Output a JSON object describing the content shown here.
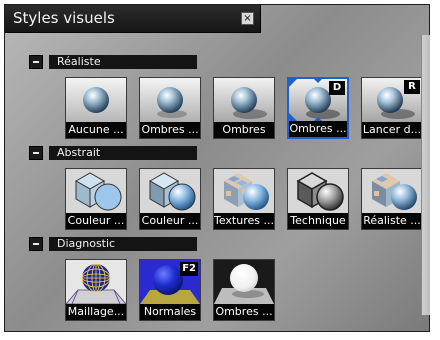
{
  "window": {
    "title": "Styles visuels",
    "close_symbol": "×"
  },
  "sections": [
    {
      "label": "Réaliste",
      "items": [
        {
          "label": "Aucune ...",
          "badge": "",
          "icon": "sphere-no-shadow-icon"
        },
        {
          "label": "Ombres ...",
          "badge": "",
          "icon": "sphere-ground-shadow-icon"
        },
        {
          "label": "Ombres",
          "badge": "",
          "icon": "sphere-shadow-icon"
        },
        {
          "label": "Ombres ...",
          "badge": "D",
          "icon": "sphere-full-shadow-icon",
          "selected": true
        },
        {
          "label": "Lancer d...",
          "badge": "R",
          "icon": "sphere-raytrace-icon"
        }
      ]
    },
    {
      "label": "Abstrait",
      "items": [
        {
          "label": "Couleur ...",
          "badge": "",
          "icon": "cube-flat-color-icon"
        },
        {
          "label": "Couleur ...",
          "badge": "",
          "icon": "cube-gradient-color-icon"
        },
        {
          "label": "Textures ...",
          "badge": "",
          "icon": "cube-textures-icon"
        },
        {
          "label": "Technique",
          "badge": "",
          "icon": "cube-technical-icon"
        },
        {
          "label": "Réaliste ...",
          "badge": "",
          "icon": "cube-realistic-icon"
        }
      ]
    },
    {
      "label": "Diagnostic",
      "items": [
        {
          "label": "Maillage...",
          "badge": "",
          "icon": "mesh-sphere-icon"
        },
        {
          "label": "Normales",
          "badge": "F2",
          "icon": "normals-sphere-icon"
        },
        {
          "label": "Ombres ...",
          "badge": "",
          "icon": "white-sphere-shadow-icon"
        }
      ]
    }
  ]
}
